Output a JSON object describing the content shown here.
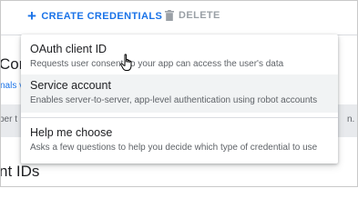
{
  "toolbar": {
    "create_label": "CREATE CREDENTIALS",
    "delete_label": "DELETE"
  },
  "background": {
    "heading1": "Con",
    "link": "nals v",
    "row_text": "per t",
    "row_right": "n.",
    "heading2": "nt IDs"
  },
  "menu": {
    "items": [
      {
        "title": "OAuth client ID",
        "description": "Requests user consent so your app can access the user's data"
      },
      {
        "title": "Service account",
        "description": "Enables server-to-server, app-level authentication using robot accounts"
      },
      {
        "title": "Help me choose",
        "description": "Asks a few questions to help you decide which type of credential to use"
      }
    ]
  },
  "colors": {
    "accent": "#1a73e8",
    "disabled": "#9aa0a6",
    "hover": "#f1f3f4"
  },
  "icons": {
    "create": "plus-icon",
    "delete": "trash-icon",
    "cursor": "hand-pointer-icon"
  }
}
